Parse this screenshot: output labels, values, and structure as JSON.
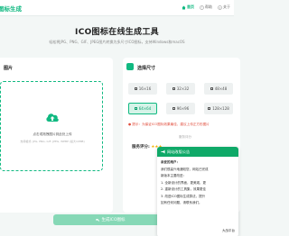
{
  "nav": {
    "brand": "图标生成",
    "items": [
      {
        "label": "首页",
        "icon": "home-icon",
        "active": true
      },
      {
        "label": "帮助",
        "icon": "help-icon",
        "active": false
      },
      {
        "label": "关于",
        "icon": "info-icon",
        "active": false
      }
    ]
  },
  "hero": {
    "title": "ICO图标在线生成工具",
    "subtitle": "轻松将JPG、PNG、GIF、JPEG图片转换为多尺寸ICO图标，支持Windows和macOS"
  },
  "upload": {
    "header": "图片",
    "text": "点击或拖拽图片到此处上传",
    "hint": "支持格式: JPG, PNG, GIF, JPEG, WEBP (最大10MB)"
  },
  "sizes": {
    "header": "选择尺寸",
    "options": [
      "16×16",
      "32×32",
      "48×48",
      "64×64",
      "96×96",
      "128×128"
    ],
    "selected": "64×64",
    "tip": "提示：为保证ICO图标效果最佳，建议上传正方形图片"
  },
  "rating": {
    "label": "服务评分:",
    "stars": "★★★",
    "faint_label": "服务评分"
  },
  "convert_button": "生成ICO图标",
  "announcement": {
    "title": "网站改版公告",
    "greeting": "亲爱的用户：",
    "lines": [
      "我们很高兴地通知您，网站已完成",
      "新版本主要改进：",
      "1. 全新设计的界面，更美观、更",
      "2. 重新设计的工具集，效果更佳",
      "3. 改进ICO图标生成算法，提升",
      "如有任何问题，请联系我们。"
    ],
    "contact_link": "联系我们",
    "signature": "大战平台"
  },
  "colors": {
    "accent": "#10b981",
    "button_disabled": "#86d8b6",
    "popup_header": "#0fa968",
    "tip": "#e04b3a",
    "stars": "#f4b400"
  }
}
